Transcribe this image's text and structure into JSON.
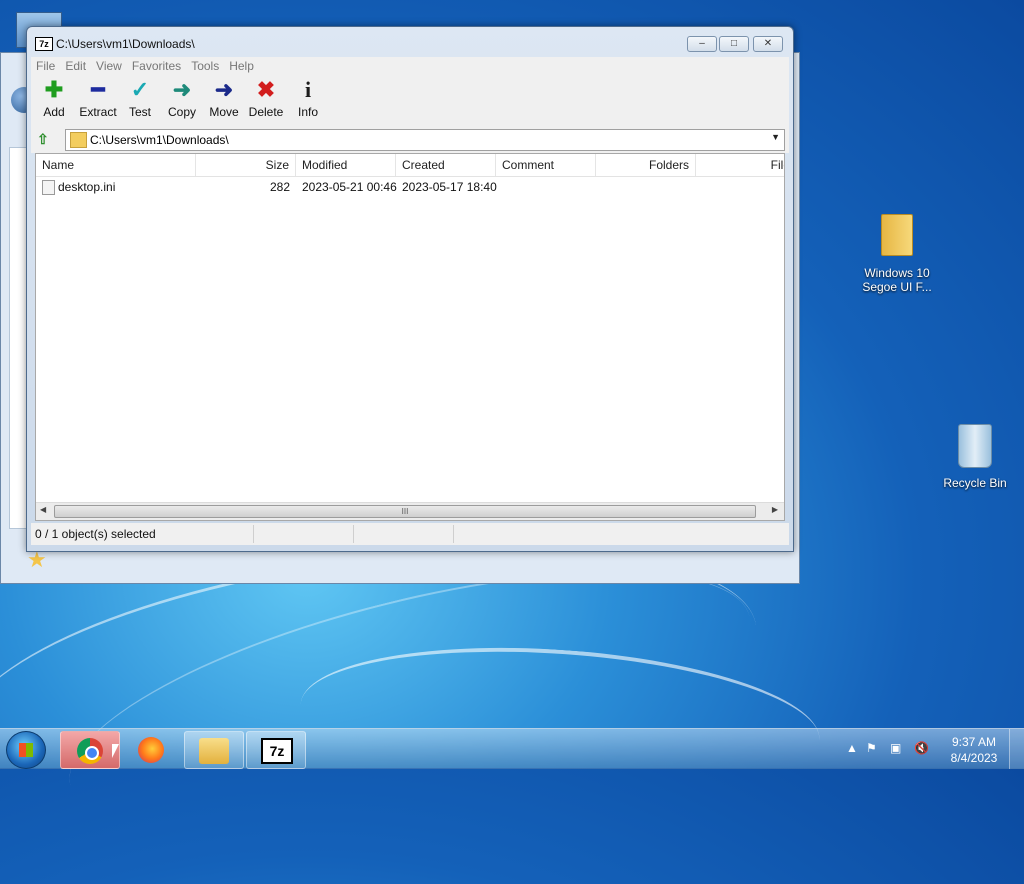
{
  "window": {
    "title": "C:\\Users\\vm1\\Downloads\\",
    "app_icon_text": "7z",
    "controls": {
      "minimize": "–",
      "maximize": "□",
      "close": "✕"
    }
  },
  "menu": [
    "File",
    "Edit",
    "View",
    "Favorites",
    "Tools",
    "Help"
  ],
  "toolbar": [
    {
      "label": "Add",
      "icon": "add-icon",
      "glyph": "✚",
      "color": "#1f9d1f"
    },
    {
      "label": "Extract",
      "icon": "extract-icon",
      "glyph": "━",
      "color": "#1d2b9e"
    },
    {
      "label": "Test",
      "icon": "test-icon",
      "glyph": "✓",
      "color": "#1aa9b3"
    },
    {
      "label": "Copy",
      "icon": "copy-icon",
      "glyph": "➜",
      "color": "#1e8a7a"
    },
    {
      "label": "Move",
      "icon": "move-icon",
      "glyph": "➜",
      "color": "#1b2a8a"
    },
    {
      "label": "Delete",
      "icon": "delete-icon",
      "glyph": "✖",
      "color": "#d21d1d"
    },
    {
      "label": "Info",
      "icon": "info-icon",
      "glyph": "i",
      "color": "#1d1d1d"
    }
  ],
  "address": {
    "path": "C:\\Users\\vm1\\Downloads\\"
  },
  "columns": [
    "Name",
    "Size",
    "Modified",
    "Created",
    "Comment",
    "Folders",
    "File"
  ],
  "files": [
    {
      "name": "desktop.ini",
      "size": "282",
      "modified": "2023-05-21 00:46",
      "created": "2023-05-17 18:40"
    }
  ],
  "status": {
    "selection": "0 / 1 object(s) selected"
  },
  "scroll": {
    "grip": "III"
  },
  "desktop": {
    "folder_label_line1": "Windows 10",
    "folder_label_line2": "Segoe UI F...",
    "recycle_bin_label": "Recycle Bin"
  },
  "taskbar": {
    "apps": [
      "chrome",
      "firefox",
      "explorer",
      "7-zip"
    ],
    "sevenzip_text": "7z",
    "time": "9:37 AM",
    "date": "8/4/2023"
  }
}
